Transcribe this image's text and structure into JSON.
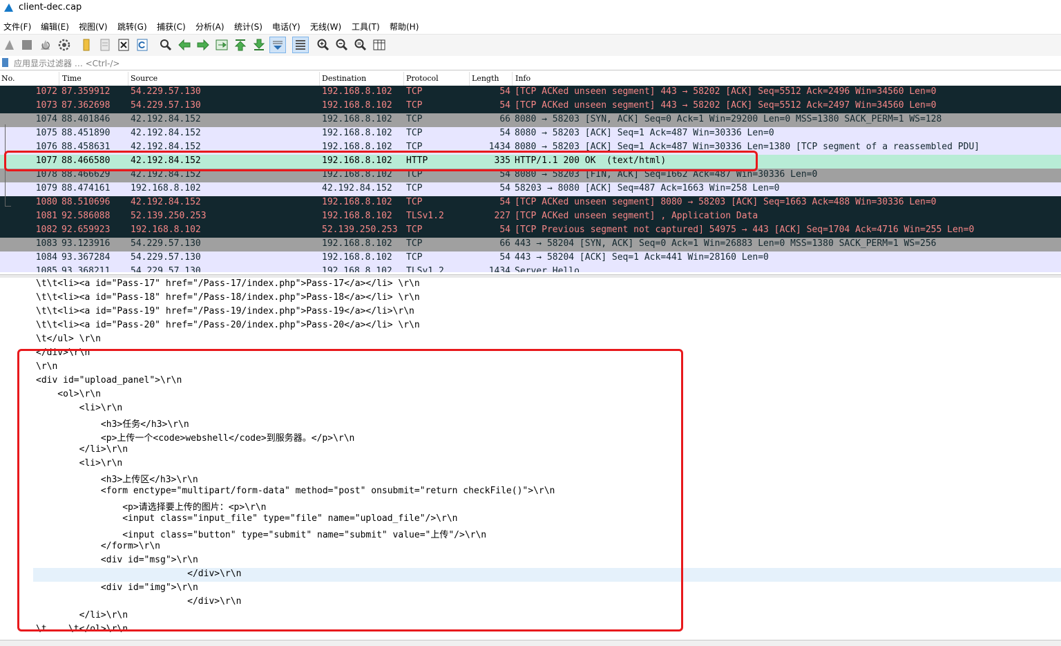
{
  "window": {
    "title": "client-dec.cap"
  },
  "menu": [
    "文件(F)",
    "编辑(E)",
    "视图(V)",
    "跳转(G)",
    "捕获(C)",
    "分析(A)",
    "统计(S)",
    "电话(Y)",
    "无线(W)",
    "工具(T)",
    "帮助(H)"
  ],
  "toolbar": [
    "shark-fin-start-icon",
    "stop-square-icon",
    "restart-fin-icon",
    "capture-options-gear-icon",
    "open-folder-icon",
    "save-file-icon",
    "close-file-icon",
    "reload-icon",
    "find-magnifier-icon",
    "go-back-arrow-icon",
    "go-forward-arrow-icon",
    "go-to-packet-icon",
    "first-packet-icon",
    "last-packet-icon",
    "autoscroll-icon",
    "colorize-icon",
    "zoom-in-icon",
    "zoom-out-icon",
    "normal-size-icon",
    "resize-columns-icon"
  ],
  "filter": {
    "placeholder": "应用显示过滤器 … <Ctrl-/>"
  },
  "columns": {
    "no": "No.",
    "time": "Time",
    "source": "Source",
    "destination": "Destination",
    "protocol": "Protocol",
    "length": "Length",
    "info": "Info"
  },
  "colors": {
    "dark_bg": "#12272e",
    "dark_fg": "#f78787",
    "gray_bg": "#a0a0a0",
    "lavender_bg": "#e7e6ff",
    "selected_bg": "#b8ecd6",
    "highlight_box": "#e8191c"
  },
  "packets": [
    {
      "no": "1072",
      "time": "87.359912",
      "src": "54.229.57.130",
      "dst": "192.168.8.102",
      "proto": "TCP",
      "len": "54",
      "info": "[TCP ACKed unseen segment] 443 → 58202 [ACK] Seq=5512 Ack=2496 Win=34560 Len=0",
      "style": "dark"
    },
    {
      "no": "1073",
      "time": "87.362698",
      "src": "54.229.57.130",
      "dst": "192.168.8.102",
      "proto": "TCP",
      "len": "54",
      "info": "[TCP ACKed unseen segment] 443 → 58202 [ACK] Seq=5512 Ack=2497 Win=34560 Len=0",
      "style": "dark"
    },
    {
      "no": "1074",
      "time": "88.401846",
      "src": "42.192.84.152",
      "dst": "192.168.8.102",
      "proto": "TCP",
      "len": "66",
      "info": "8080 → 58203 [SYN, ACK] Seq=0 Ack=1 Win=29200 Len=0 MSS=1380 SACK_PERM=1 WS=128",
      "style": "gray"
    },
    {
      "no": "1075",
      "time": "88.451890",
      "src": "42.192.84.152",
      "dst": "192.168.8.102",
      "proto": "TCP",
      "len": "54",
      "info": "8080 → 58203 [ACK] Seq=1 Ack=487 Win=30336 Len=0",
      "style": "lav"
    },
    {
      "no": "1076",
      "time": "88.458631",
      "src": "42.192.84.152",
      "dst": "192.168.8.102",
      "proto": "TCP",
      "len": "1434",
      "info": "8080 → 58203 [ACK] Seq=1 Ack=487 Win=30336 Len=1380 [TCP segment of a reassembled PDU]",
      "style": "lav"
    },
    {
      "no": "1077",
      "time": "88.466580",
      "src": "42.192.84.152",
      "dst": "192.168.8.102",
      "proto": "HTTP",
      "len": "335",
      "info": "HTTP/1.1 200 OK  (text/html)",
      "style": "sel"
    },
    {
      "no": "1078",
      "time": "88.466629",
      "src": "42.192.84.152",
      "dst": "192.168.8.102",
      "proto": "TCP",
      "len": "54",
      "info": "8080 → 58203 [FIN, ACK] Seq=1662 Ack=487 Win=30336 Len=0",
      "style": "gray"
    },
    {
      "no": "1079",
      "time": "88.474161",
      "src": "192.168.8.102",
      "dst": "42.192.84.152",
      "proto": "TCP",
      "len": "54",
      "info": "58203 → 8080 [ACK] Seq=487 Ack=1663 Win=258 Len=0",
      "style": "lav"
    },
    {
      "no": "1080",
      "time": "88.510696",
      "src": "42.192.84.152",
      "dst": "192.168.8.102",
      "proto": "TCP",
      "len": "54",
      "info": "[TCP ACKed unseen segment] 8080 → 58203 [ACK] Seq=1663 Ack=488 Win=30336 Len=0",
      "style": "dark"
    },
    {
      "no": "1081",
      "time": "92.586088",
      "src": "52.139.250.253",
      "dst": "192.168.8.102",
      "proto": "TLSv1.2",
      "len": "227",
      "info": "[TCP ACKed unseen segment] , Application Data",
      "style": "dark"
    },
    {
      "no": "1082",
      "time": "92.659923",
      "src": "192.168.8.102",
      "dst": "52.139.250.253",
      "proto": "TCP",
      "len": "54",
      "info": "[TCP Previous segment not captured] 54975 → 443 [ACK] Seq=1704 Ack=4716 Win=255 Len=0",
      "style": "dark"
    },
    {
      "no": "1083",
      "time": "93.123916",
      "src": "54.229.57.130",
      "dst": "192.168.8.102",
      "proto": "TCP",
      "len": "66",
      "info": "443 → 58204 [SYN, ACK] Seq=0 Ack=1 Win=26883 Len=0 MSS=1380 SACK_PERM=1 WS=256",
      "style": "gray"
    },
    {
      "no": "1084",
      "time": "93.367284",
      "src": "54.229.57.130",
      "dst": "192.168.8.102",
      "proto": "TCP",
      "len": "54",
      "info": "443 → 58204 [ACK] Seq=1 Ack=441 Win=28160 Len=0",
      "style": "lav"
    },
    {
      "no": "1085",
      "time": "93.368211",
      "src": "54.229.57.130",
      "dst": "192.168.8.102",
      "proto": "TLSv1.2",
      "len": "1434",
      "info": "Server Hello",
      "style": "lav"
    }
  ],
  "bytes_pane": [
    {
      "text": "\\t\\t<li><a id=\"Pass-17\" href=\"/Pass-17/index.php\">Pass-17</a></li> \\r\\n",
      "hl": false
    },
    {
      "text": "\\t\\t<li><a id=\"Pass-18\" href=\"/Pass-18/index.php\">Pass-18</a></li> \\r\\n",
      "hl": false
    },
    {
      "text": "\\t\\t<li><a id=\"Pass-19\" href=\"/Pass-19/index.php\">Pass-19</a></li>\\r\\n",
      "hl": false
    },
    {
      "text": "\\t\\t<li><a id=\"Pass-20\" href=\"/Pass-20/index.php\">Pass-20</a></li> \\r\\n",
      "hl": false
    },
    {
      "text": "\\t</ul> \\r\\n",
      "hl": false
    },
    {
      "text": "</div>\\r\\n",
      "hl": false
    },
    {
      "text": "\\r\\n",
      "hl": false
    },
    {
      "text": "<div id=\"upload_panel\">\\r\\n",
      "hl": false
    },
    {
      "text": "    <ol>\\r\\n",
      "hl": false
    },
    {
      "text": "        <li>\\r\\n",
      "hl": false
    },
    {
      "text": "            <h3>任务</h3>\\r\\n",
      "hl": false
    },
    {
      "text": "            <p>上传一个<code>webshell</code>到服务器。</p>\\r\\n",
      "hl": false
    },
    {
      "text": "        </li>\\r\\n",
      "hl": false
    },
    {
      "text": "        <li>\\r\\n",
      "hl": false
    },
    {
      "text": "            <h3>上传区</h3>\\r\\n",
      "hl": false
    },
    {
      "text": "            <form enctype=\"multipart/form-data\" method=\"post\" onsubmit=\"return checkFile()\">\\r\\n",
      "hl": false
    },
    {
      "text": "                <p>请选择要上传的图片：<p>\\r\\n",
      "hl": false
    },
    {
      "text": "                <input class=\"input_file\" type=\"file\" name=\"upload_file\"/>\\r\\n",
      "hl": false
    },
    {
      "text": "                <input class=\"button\" type=\"submit\" name=\"submit\" value=\"上传\"/>\\r\\n",
      "hl": false
    },
    {
      "text": "            </form>\\r\\n",
      "hl": false
    },
    {
      "text": "            <div id=\"msg\">\\r\\n",
      "hl": false
    },
    {
      "text": "                            </div>\\r\\n",
      "hl": true
    },
    {
      "text": "            <div id=\"img\">\\r\\n",
      "hl": false
    },
    {
      "text": "                            </div>\\r\\n",
      "hl": false
    },
    {
      "text": "        </li>\\r\\n",
      "hl": false
    },
    {
      "text": "\\t    \\t</ol>\\r\\n",
      "hl": false
    }
  ]
}
